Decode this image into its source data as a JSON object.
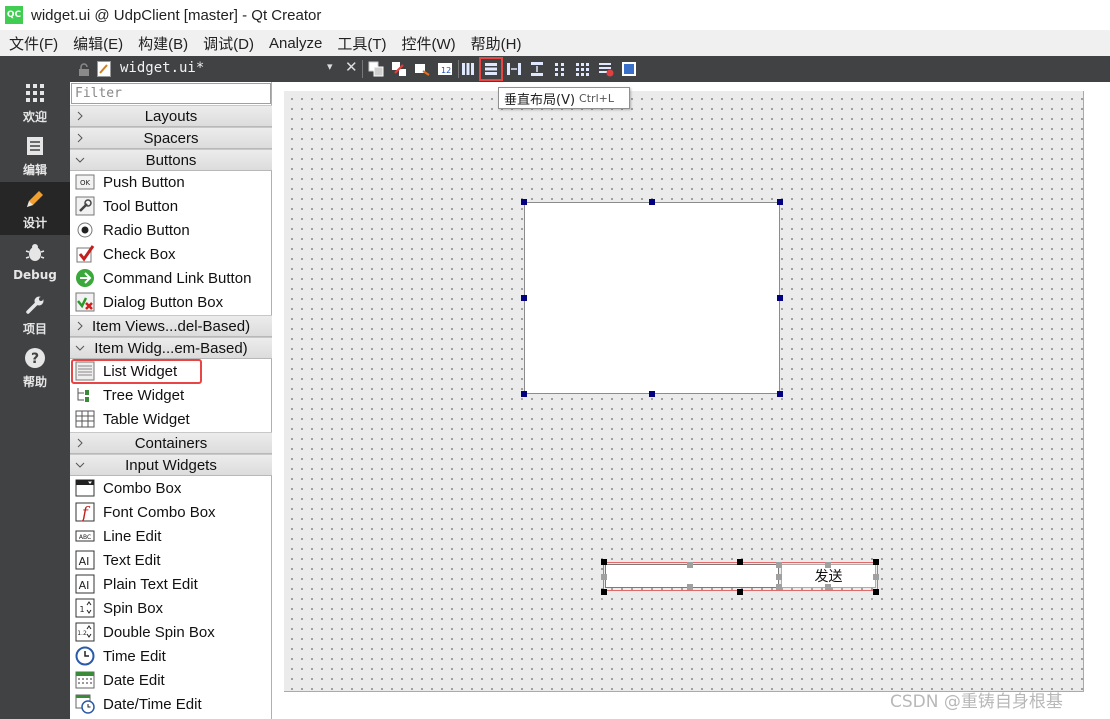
{
  "window": {
    "logo_text": "QC",
    "title": "widget.ui @ UdpClient [master] - Qt Creator"
  },
  "menubar": {
    "items": [
      "文件(F)",
      "编辑(E)",
      "构建(B)",
      "调试(D)",
      "Analyze",
      "工具(T)",
      "控件(W)",
      "帮助(H)"
    ]
  },
  "modes": [
    {
      "label": "欢迎",
      "icon": "grid-icon"
    },
    {
      "label": "编辑",
      "icon": "document-icon"
    },
    {
      "label": "设计",
      "icon": "pencil-icon"
    },
    {
      "label": "Debug",
      "icon": "bug-icon"
    },
    {
      "label": "项目",
      "icon": "wrench-icon"
    },
    {
      "label": "帮助",
      "icon": "question-icon"
    }
  ],
  "active_mode": "设计",
  "editor": {
    "file_name": "widget.ui*",
    "dropdown_glyph": "▾",
    "close_glyph": "✕"
  },
  "tooltip": {
    "text": "垂直布局(V)",
    "shortcut": "Ctrl+L"
  },
  "widgetbox": {
    "filter_placeholder": "Filter",
    "categories": {
      "layouts": "Layouts",
      "spacers": "Spacers",
      "buttons": "Buttons",
      "item_views": "Item Views...del-Based)",
      "item_widgets": "Item Widg...em-Based)",
      "containers": "Containers",
      "input_widgets": "Input Widgets"
    },
    "button_items": [
      "Push Button",
      "Tool Button",
      "Radio Button",
      "Check Box",
      "Command Link Button",
      "Dialog Button Box"
    ],
    "item_widget_items": [
      "List Widget",
      "Tree Widget",
      "Table Widget"
    ],
    "input_items": [
      "Combo Box",
      "Font Combo Box",
      "Line Edit",
      "Text Edit",
      "Plain Text Edit",
      "Spin Box",
      "Double Spin Box",
      "Time Edit",
      "Date Edit",
      "Date/Time Edit"
    ],
    "highlighted_item": "List Widget"
  },
  "form": {
    "send_button_label": "发送"
  },
  "watermark": "CSDN @重铸自身根基",
  "colors": {
    "modebar_bg": "#404244",
    "active_mode_bg": "#262626",
    "highlight_red": "#e84545",
    "handle_blue": "#000080"
  }
}
